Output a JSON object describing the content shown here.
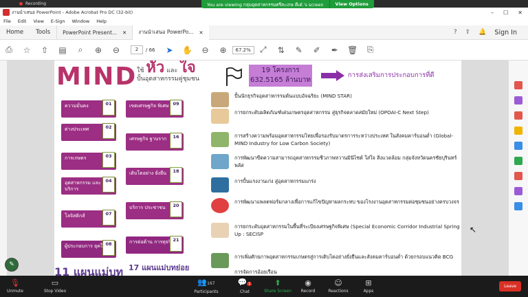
{
  "zoom_top": {
    "recording": "Recording",
    "viewing_text": "You are viewing กลุ่มอุตสาหกรรมศรีสะเกษ ตีเด๋.'s screen",
    "view_options": "View Options"
  },
  "acrobat": {
    "window_title": "งานนำเสนอ PowerPoint - Adobe Acrobat Pro DC (32-bit)",
    "menu": [
      "File",
      "Edit",
      "View",
      "E-Sign",
      "Window",
      "Help"
    ],
    "nav": [
      "Home",
      "Tools"
    ],
    "tabs": [
      "PowerPoint Present...",
      "งานนำเสนอ PowerPo..."
    ],
    "sign_in": "Sign In",
    "page_current": "2",
    "page_total": "/ 66",
    "zoom": "67.2%"
  },
  "slide": {
    "mind": "MIND",
    "sub_top": "ใช้",
    "sub_hua": "หัว",
    "sub_and": "และ",
    "sub_jai": "ใจ",
    "sub_bottom": "ปั้นอุตสาหกรรมคู่ชุมชน",
    "box_line1": "19 โครงการ",
    "box_line2": "632.5165 ล้านบาท",
    "promo": "การส่งเสริมการประกอบการที่ดี",
    "left_pills": [
      {
        "label": "ความมั่นคง",
        "num": "01"
      },
      {
        "label": "ต่างประเทศ",
        "num": "02"
      },
      {
        "label": "การเกษตร",
        "num": "03"
      },
      {
        "label": "อุตสาหกรรม และบริการ",
        "num": "04"
      },
      {
        "label": "โลจิสติกส์",
        "num": "07"
      },
      {
        "label": "ผู้ประกอบการ ยุคใหม่",
        "num": "08"
      }
    ],
    "right_pills": [
      {
        "label": "เขตเศรษฐกิจ พิเศษ",
        "num": "09"
      },
      {
        "label": "เศรษฐกิจ ฐานราก",
        "num": "16"
      },
      {
        "label": "เติบโตอย่าง ยั่งยืน",
        "num": "18"
      },
      {
        "label": "บริการ ประชาชน",
        "num": "20"
      },
      {
        "label": "การต่อต้าน การทุจริต",
        "num": "21"
      }
    ],
    "bottom_left": "11 แผนแม่บท",
    "bottom_right": "17 แผนแม่บทย่อย",
    "items": [
      "ปั้นนักธุรกิจอุตสาหกรรมต้นแบบอัจฉริยะ (MIND STAR)",
      "การยกระดับผลิตภัณฑ์เด่นเกษตรอุตสาหกรรม สู่ธุรกิจตลาดสมัยใหม่ (OPOAI-C Next Step)",
      "การสร้างความพร้อมอุตสาหกรรมไทยเพื่อรองรับมาตรการระหว่างประเทศ ในสังคมคาร์บอนต่ำ (Global-MIND Industry for Low Carbon Society)",
      "การพัฒนาขีดความสามารถอุตสาหกรรมชีวภาพหวานมินิไซต์ ใส่ใจ สิ่งแวดล้อม กลุ่มจังหวัดนครชัยบุรินทร์พลัส",
      "การปั้นแรงงานเก่ง สู่อุตสาหกรรมแกร่ง",
      "การพัฒนาแพลตฟอร์มกลางเพื่อการแก้ไขปัญหาผลกระทบ ของโรงงานอุตสาหกรรมต่อชุมชนอย่างครบวงจร",
      "การยกระดับอุตสาหกรรมในพื้นที่ระเบียงเศรษฐกิจพิเศษ (Special Economic Corridor Industrial Spring Up : SECISP",
      "การเพิ่มศักยภาพอุตสาหกรรมเกษตรสู่การเติบโตอย่างยั่งยืนและสังคมคาร์บอนต่ำ ด้วยกรอบแนวคิด BCG",
      "การจัดการอ้อยเรือน"
    ]
  },
  "zoom_bar": {
    "unmute": "Unmute",
    "stop_video": "Stop Video",
    "participants": "Participants",
    "participants_count": "167",
    "chat": "Chat",
    "chat_badge": "1",
    "share_screen": "Share Screen",
    "record": "Record",
    "reactions": "Reactions",
    "apps": "Apps",
    "leave": "Leave"
  },
  "colors": {
    "accent": "#9c2e83",
    "brand": "#b8336a",
    "share": "#29b34a",
    "leave": "#d93025"
  }
}
